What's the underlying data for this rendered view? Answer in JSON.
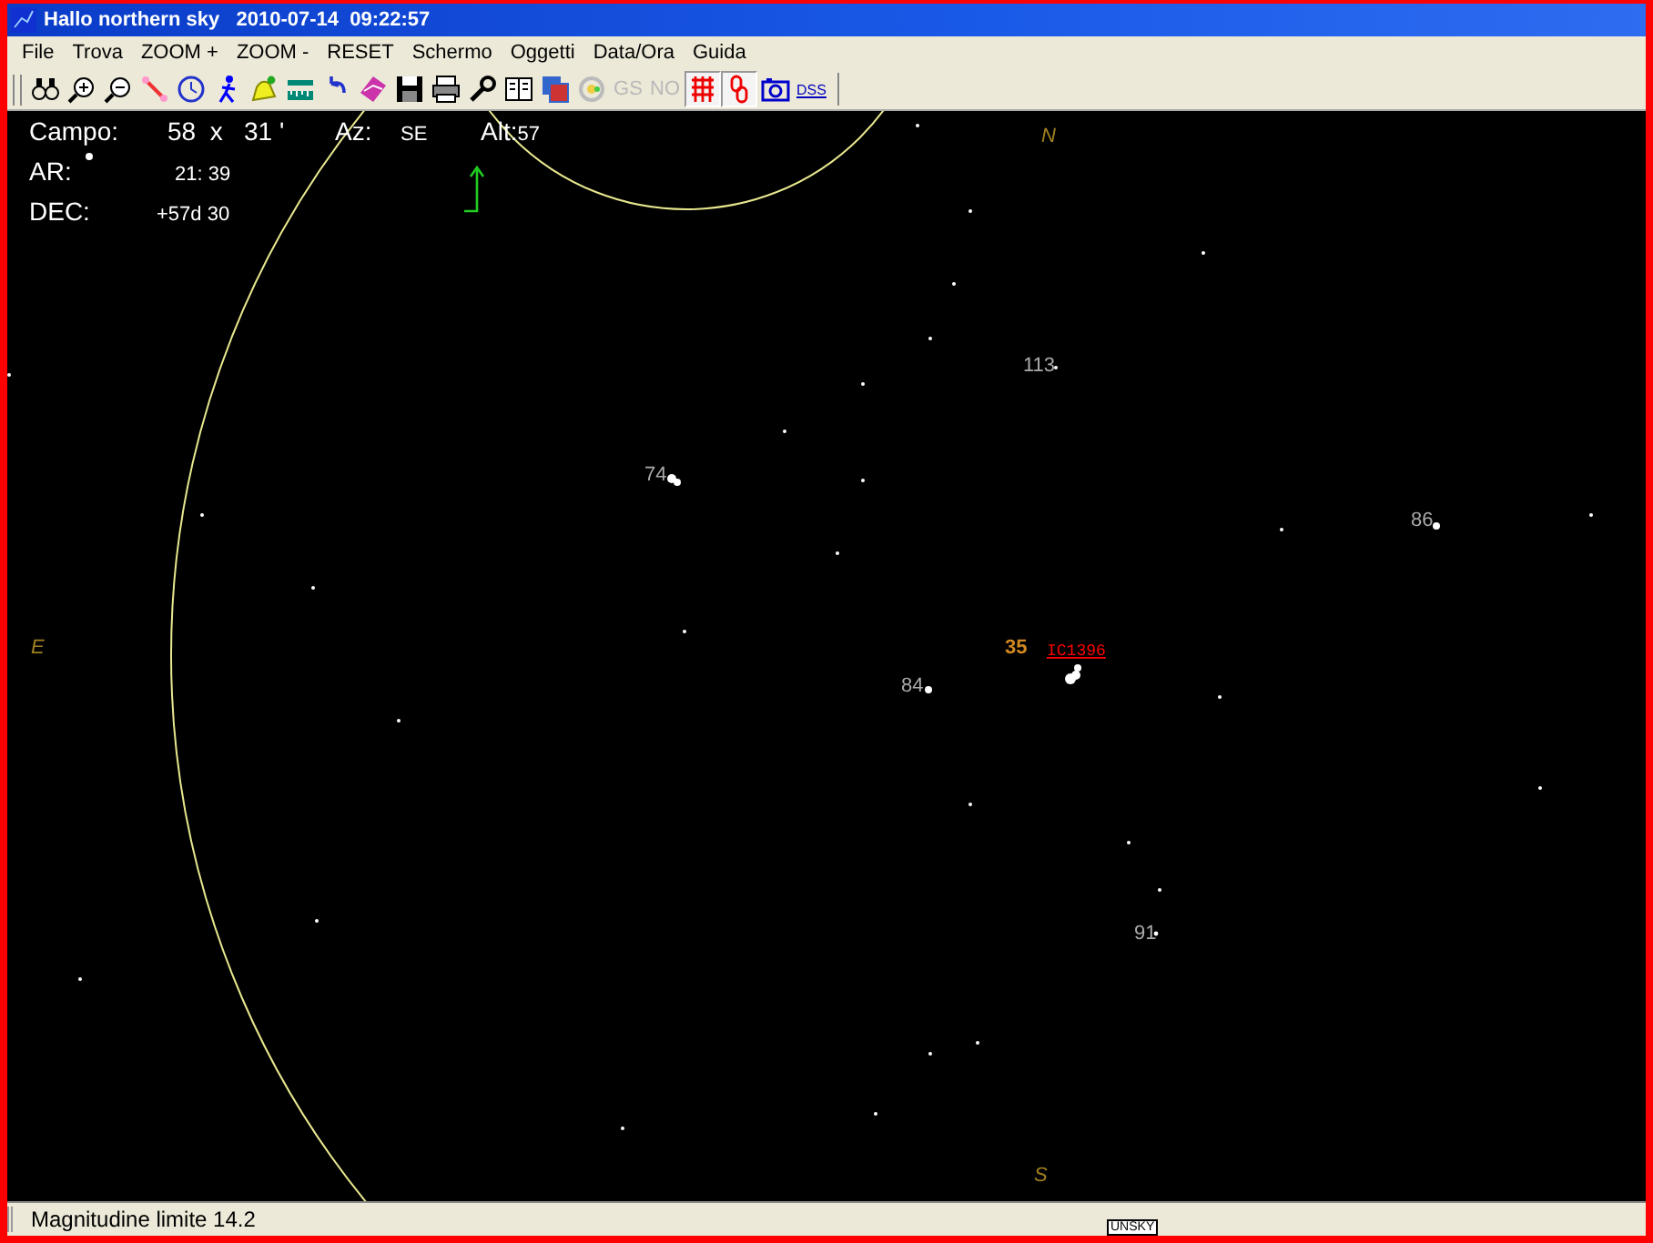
{
  "window": {
    "title": "Hallo northern sky   2010-07-14  09:22:57"
  },
  "menu": [
    "File",
    "Trova",
    "ZOOM +",
    "ZOOM -",
    "RESET",
    "Schermo",
    "Oggetti",
    "Data/Ora",
    "Guida"
  ],
  "toolbar": [
    {
      "kind": "icon",
      "on": false
    },
    {
      "kind": "icon",
      "on": false
    },
    {
      "kind": "icon",
      "on": false
    },
    {
      "kind": "icon",
      "on": false
    },
    {
      "kind": "icon",
      "on": false
    },
    {
      "kind": "icon",
      "on": false
    },
    {
      "kind": "icon",
      "on": false
    },
    {
      "kind": "icon",
      "on": false
    },
    {
      "kind": "icon",
      "on": false
    },
    {
      "kind": "icon",
      "on": false
    },
    {
      "kind": "icon",
      "on": false
    },
    {
      "kind": "icon",
      "on": false
    },
    {
      "kind": "icon",
      "on": false
    },
    {
      "kind": "icon",
      "on": false
    },
    {
      "kind": "icon",
      "on": false
    },
    {
      "kind": "icon",
      "on": false
    },
    {
      "kind": "text",
      "label": "GS",
      "on": false,
      "disabled": true
    },
    {
      "kind": "text",
      "label": "NO",
      "on": false,
      "disabled": true
    },
    {
      "kind": "icon",
      "on": true
    },
    {
      "kind": "icon",
      "on": true
    },
    {
      "kind": "icon",
      "on": false
    },
    {
      "kind": "link",
      "label": "DSS",
      "on": false
    }
  ],
  "info": {
    "field_label": "Campo:",
    "field_value": "58  x   31 '",
    "az_label": "Az:",
    "az_value": "SE",
    "alt_label": "Alt:",
    "alt_value": "57",
    "ar_label": "AR:",
    "ar_value": "21: 39",
    "dec_label": "DEC:",
    "dec_value": "+57d 30"
  },
  "compass": [
    "N",
    "E",
    "S"
  ],
  "labels": [
    {
      "text": "113",
      "kind": "star"
    },
    {
      "text": "74",
      "kind": "star"
    },
    {
      "text": "86",
      "kind": "star"
    },
    {
      "text": "35",
      "kind": "object"
    },
    {
      "text": "IC1396",
      "kind": "catalog"
    },
    {
      "text": "84",
      "kind": "star"
    },
    {
      "text": "91",
      "kind": "star"
    }
  ],
  "status_bar": {
    "text": "Magnitudine limite 14.2",
    "tag": "UNSKY"
  }
}
